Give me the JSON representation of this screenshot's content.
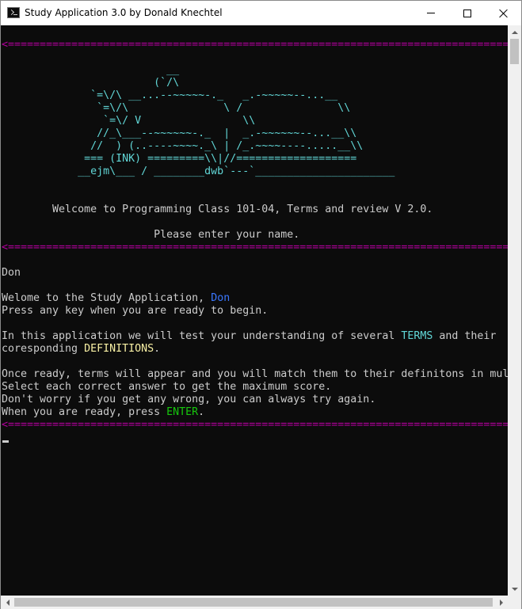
{
  "window": {
    "title": "Study Application 3.0 by Donald Knechtel",
    "icon": "console-app-icon",
    "controls": [
      "minimize-icon",
      "maximize-icon",
      "close-icon"
    ]
  },
  "colors": {
    "background": "#0c0c0c",
    "text": "#cccccc",
    "separator": "#b4009e",
    "art": "#61d6d6",
    "name_highlight": "#3b78ff",
    "terms_highlight": "#61d6d6",
    "definitions_highlight": "#f9f1a5",
    "enter_highlight": "#16c60c"
  },
  "console": {
    "separator": "<====================================================================================>",
    "ascii_art": [
      "                          __",
      "                        (`/\\",
      "              `=\\/\\ __...--~~~~~-._   _.-~~~~~--...__",
      "               `=\\/\\               \\ /               \\\\",
      "                `=\\/ V                \\\\",
      "               //_\\___--~~~~~~-._  |  _.-~~~~~~--...__\\\\",
      "              //  ) (..----~~~~._\\ | /_.~~~~----.....__\\\\",
      "             === (INK) =========\\\\|//===================",
      "            __ejm\\___ / ________dwb`---`______________________"
    ],
    "welcome_line": "        Welcome to Programming Class 101-04, Terms and review V 2.0.",
    "name_prompt": "                        Please enter your name.",
    "user_input": "Don",
    "greeting_prefix": "Welome to the Study Application, ",
    "greeting_name": "Don",
    "press_key": "Press any key when you are ready to begin.",
    "intro_prefix": "In this application we will test your understanding of several ",
    "intro_terms": "TERMS",
    "intro_and": " and their",
    "intro2_prefix": "coresponding ",
    "intro2_definitions": "DEFINITIONS",
    "intro2_suffix": ".",
    "once_ready": "Once ready, terms will appear and you will match them to their definitons in mul",
    "select_each": "Select each correct answer to get the maximum score.",
    "dont_worry": "Don't worry if you get any wrong, you can always try again.",
    "when_ready_prefix": "When you are ready, press ",
    "when_ready_enter": "ENTER",
    "when_ready_suffix": "."
  }
}
